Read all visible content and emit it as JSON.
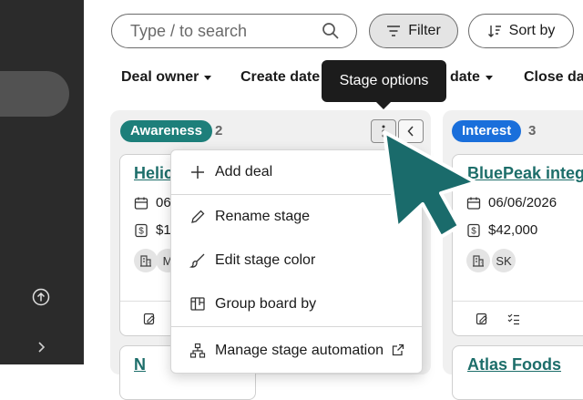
{
  "search": {
    "placeholder": "Type / to search"
  },
  "toolbar": {
    "filter_label": "Filter",
    "sort_label": "Sort by"
  },
  "facets": [
    {
      "label": "Deal owner"
    },
    {
      "label": "Create date"
    },
    {
      "label": "date"
    },
    {
      "label": "Close date"
    }
  ],
  "tooltip": {
    "text": "Stage options"
  },
  "stages": [
    {
      "name": "Awareness",
      "count": "2",
      "color": "#1d7f7a",
      "card": {
        "title": "Helic",
        "date": "06",
        "amount": "$1",
        "avatar": "M"
      },
      "next_card_title": "N"
    },
    {
      "name": "Interest",
      "count": "3",
      "color": "#1a6fdb",
      "card": {
        "title": "BluePeak integ",
        "date": "06/06/2026",
        "amount": "$42,000",
        "avatar": "SK"
      },
      "next_card_title": "Atlas Foods"
    }
  ],
  "menu": {
    "items": [
      {
        "label": "Add deal",
        "icon": "plus-icon"
      },
      {
        "label": "Rename stage",
        "icon": "pencil-icon"
      },
      {
        "label": "Edit stage color",
        "icon": "brush-icon"
      },
      {
        "label": "Group board by",
        "icon": "board-icon"
      },
      {
        "label": "Manage stage automation",
        "icon": "automation-icon"
      }
    ]
  },
  "colors": {
    "accent_teal": "#1d7f7a",
    "interest_blue": "#1a6fdb",
    "cursor": "#1a6b6b",
    "sidebar": "#2b2b2b"
  }
}
